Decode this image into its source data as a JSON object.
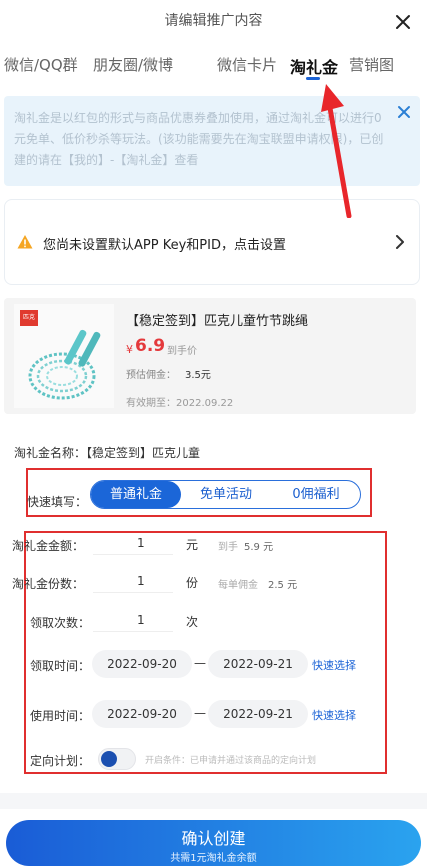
{
  "header": {
    "title": "请编辑推广内容"
  },
  "tabs": [
    {
      "label": "微信/QQ群"
    },
    {
      "label": "朋友圈/微博"
    },
    {
      "label": "微信卡片"
    },
    {
      "label": "淘礼金"
    },
    {
      "label": "营销图"
    }
  ],
  "notice": {
    "text": "淘礼金是以红包的形式与商品优惠券叠加使用，通过淘礼金可以进行0元免单、低价秒杀等玩法。(该功能需要先在淘宝联盟申请权限)，已创建的请在【我的】-【淘礼金】查看"
  },
  "warning": {
    "text": "您尚未设置默认APP Key和PID，点击设置"
  },
  "product": {
    "logo_text": "匹克",
    "title": "【稳定签到】匹克儿童竹节跳绳",
    "price_symbol": "¥",
    "price": "6.9",
    "price_suffix": "到手价",
    "commission_label": "预估佣金：",
    "commission_value": "3.5元",
    "expire": "有效期至：2022.09.22"
  },
  "name_row": {
    "label": "淘礼金名称：",
    "value": "【稳定签到】匹克儿童"
  },
  "quick_fill": {
    "label": "快速填写：",
    "options": [
      "普通礼金",
      "免单活动",
      "0佣福利"
    ],
    "selected": "普通礼金"
  },
  "form": {
    "amount": {
      "label": "淘礼金金额：",
      "value": "1",
      "unit": "元",
      "hint_label": "到手",
      "hint_value": "5.9 元"
    },
    "shares": {
      "label": "淘礼金份数：",
      "value": "1",
      "unit": "份",
      "hint_label": "每单佣金",
      "hint_value": "2.5 元"
    },
    "times": {
      "label": "领取次数：",
      "value": "1",
      "unit": "次"
    },
    "receive_time": {
      "label": "领取时间：",
      "start": "2022-09-20",
      "sep": "—",
      "end": "2022-09-21",
      "quick": "快速选择"
    },
    "use_time": {
      "label": "使用时间：",
      "start": "2022-09-20",
      "sep": "—",
      "end": "2022-09-21",
      "quick": "快速选择"
    },
    "target_plan": {
      "label": "定向计划：",
      "hint": "开启条件：已申请并通过该商品的定向计划",
      "enabled": false
    }
  },
  "cta": {
    "label": "确认创建",
    "sub": "共需1元淘礼金余额"
  },
  "colors": {
    "accent": "#1b63d6",
    "annotation": "#e02f2f",
    "price": "#e4393c"
  }
}
